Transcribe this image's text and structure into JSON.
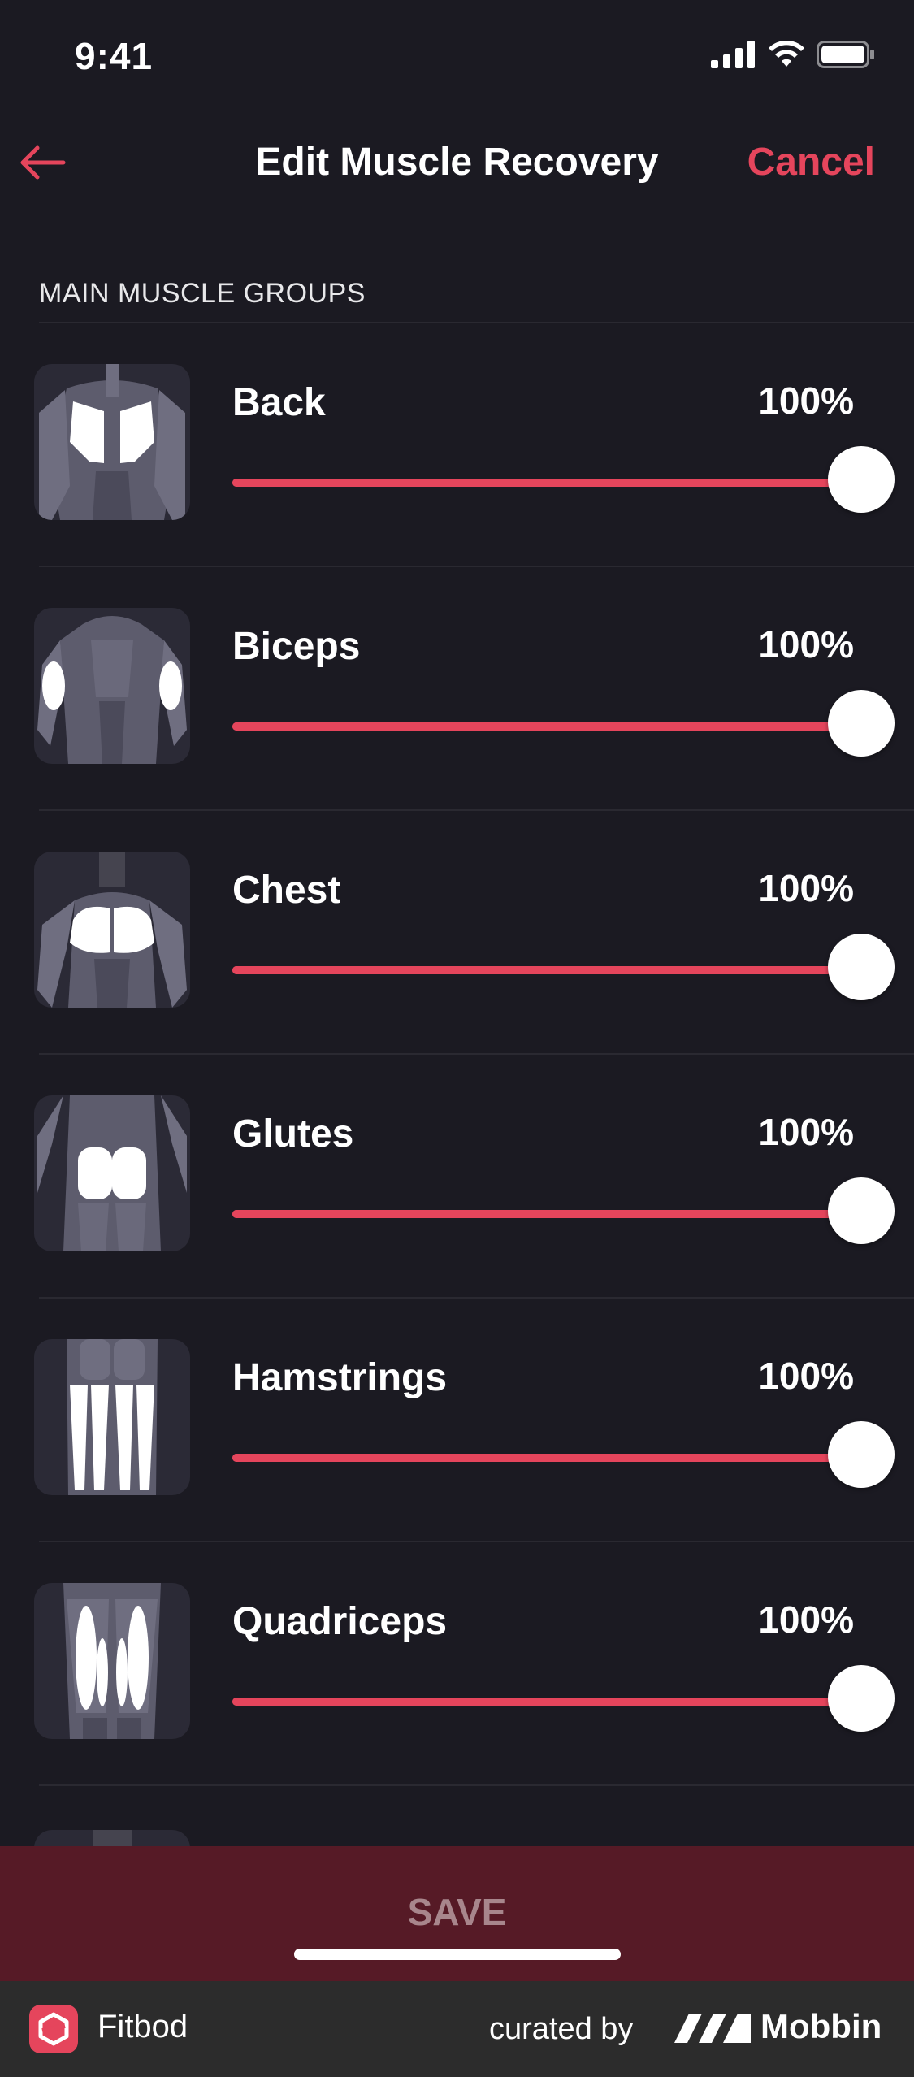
{
  "status_bar": {
    "time": "9:41"
  },
  "nav": {
    "title": "Edit Muscle Recovery",
    "cancel_label": "Cancel"
  },
  "section": {
    "header": "MAIN MUSCLE GROUPS"
  },
  "muscles": [
    {
      "name": "Back",
      "value_label": "100%",
      "value": 1.0
    },
    {
      "name": "Biceps",
      "value_label": "100%",
      "value": 1.0
    },
    {
      "name": "Chest",
      "value_label": "100%",
      "value": 1.0
    },
    {
      "name": "Glutes",
      "value_label": "100%",
      "value": 1.0
    },
    {
      "name": "Hamstrings",
      "value_label": "100%",
      "value": 1.0
    },
    {
      "name": "Quadriceps",
      "value_label": "100%",
      "value": 1.0
    }
  ],
  "save": {
    "label": "SAVE"
  },
  "footer": {
    "app_name": "Fitbod",
    "curated_by": "curated by",
    "brand": "Mobbin"
  },
  "colors": {
    "accent": "#e5455c",
    "background": "#1b1a22",
    "save_bar": "#561a26",
    "thumb_bg": "#2b2a36"
  }
}
